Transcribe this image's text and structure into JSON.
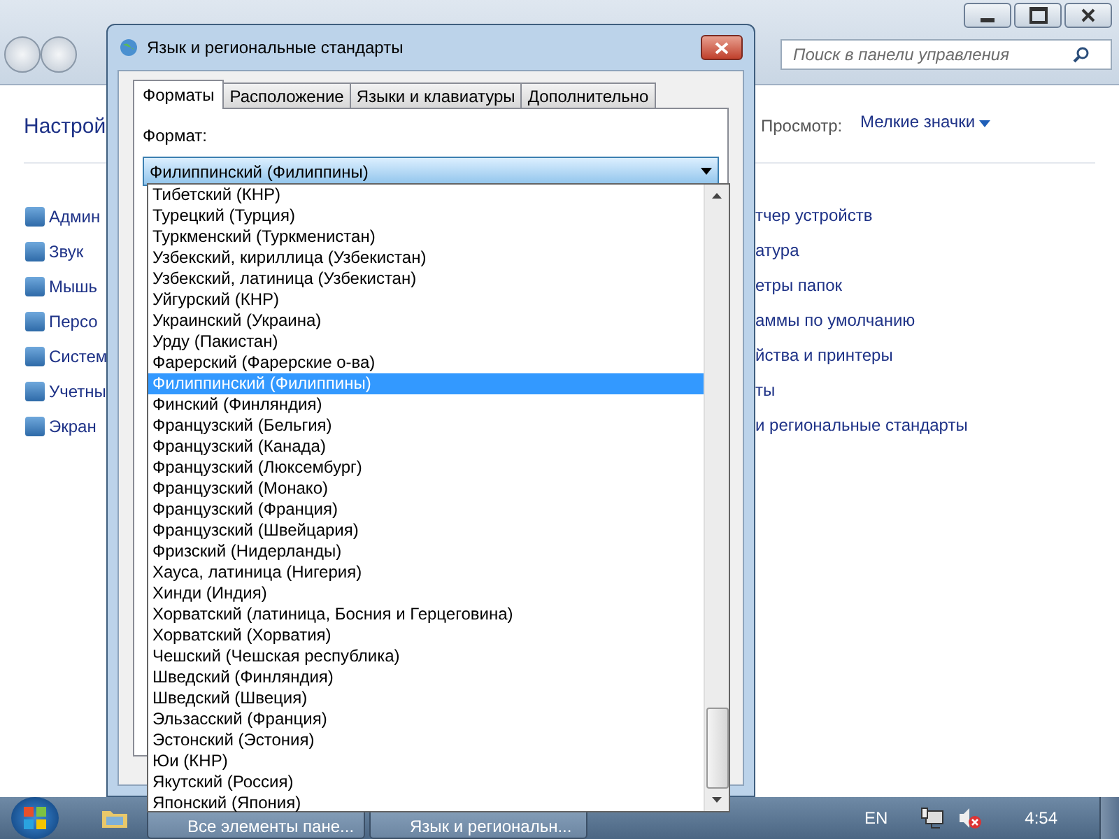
{
  "background_window": {
    "search": {
      "placeholder": "Поиск в панели управления"
    },
    "heading": "Настрой",
    "view_label": "Просмотр:",
    "view_value": "Мелкие значки",
    "left_items": [
      "Админ",
      "Звук",
      "Мышь",
      "Персо",
      "Систем",
      "Учетны",
      "Экран"
    ],
    "right_items": [
      "тчер устройств",
      "атура",
      "етры папок",
      "аммы по умолчанию",
      "йства и принтеры",
      "ты",
      "и региональные стандарты"
    ]
  },
  "dialog": {
    "title": "Язык и региональные стандарты",
    "tabs": [
      {
        "label": "Форматы",
        "selected": true
      },
      {
        "label": "Расположение",
        "selected": false
      },
      {
        "label": "Языки и клавиатуры",
        "selected": false
      },
      {
        "label": "Дополнительно",
        "selected": false
      }
    ],
    "format_label": "Формат:",
    "format_value": "Филиппинский (Филиппины)",
    "options": [
      {
        "label": "Тибетский (КНР)",
        "selected": false
      },
      {
        "label": "Турецкий (Турция)",
        "selected": false
      },
      {
        "label": "Туркменский (Туркменистан)",
        "selected": false
      },
      {
        "label": "Узбекский, кириллица (Узбекистан)",
        "selected": false
      },
      {
        "label": "Узбекский, латиница (Узбекистан)",
        "selected": false
      },
      {
        "label": "Уйгурский (КНР)",
        "selected": false
      },
      {
        "label": "Украинский (Украина)",
        "selected": false
      },
      {
        "label": "Урду (Пакистан)",
        "selected": false
      },
      {
        "label": "Фарерский (Фарерские о-ва)",
        "selected": false
      },
      {
        "label": "Филиппинский (Филиппины)",
        "selected": true
      },
      {
        "label": "Финский (Финляндия)",
        "selected": false
      },
      {
        "label": "Французский (Бельгия)",
        "selected": false
      },
      {
        "label": "Французский (Канада)",
        "selected": false
      },
      {
        "label": "Французский (Люксембург)",
        "selected": false
      },
      {
        "label": "Французский (Монако)",
        "selected": false
      },
      {
        "label": "Французский (Франция)",
        "selected": false
      },
      {
        "label": "Французский (Швейцария)",
        "selected": false
      },
      {
        "label": "Фризский (Нидерланды)",
        "selected": false
      },
      {
        "label": "Хауса, латиница (Нигерия)",
        "selected": false
      },
      {
        "label": "Хинди (Индия)",
        "selected": false
      },
      {
        "label": "Хорватский (латиница, Босния и Герцеговина)",
        "selected": false
      },
      {
        "label": "Хорватский (Хорватия)",
        "selected": false
      },
      {
        "label": "Чешский (Чешская республика)",
        "selected": false
      },
      {
        "label": "Шведский (Финляндия)",
        "selected": false
      },
      {
        "label": "Шведский (Швеция)",
        "selected": false
      },
      {
        "label": "Эльзасский (Франция)",
        "selected": false
      },
      {
        "label": "Эстонский (Эстония)",
        "selected": false
      },
      {
        "label": "Юи (КНР)",
        "selected": false
      },
      {
        "label": "Якутский (Россия)",
        "selected": false
      },
      {
        "label": "Японский (Япония)",
        "selected": false
      }
    ]
  },
  "taskbar": {
    "tasks": [
      "Все элементы пане...",
      "Язык и региональн..."
    ],
    "language": "EN",
    "clock": "4:54"
  }
}
